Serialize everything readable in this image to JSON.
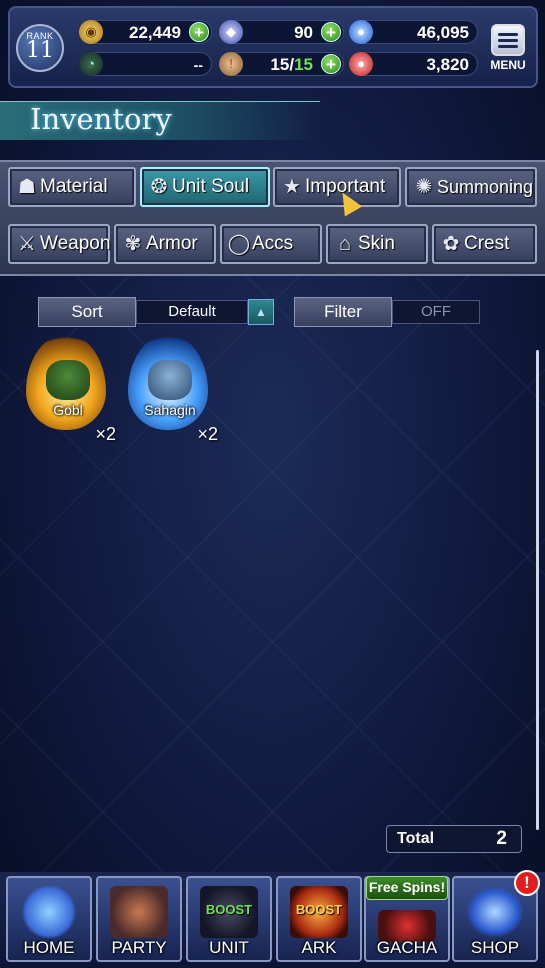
{
  "header": {
    "rank_label": "RANK",
    "rank_value": "11",
    "gil": "22,449",
    "crystals": "90",
    "orbs": "46,095",
    "experience": "--",
    "stamina_current": "15",
    "stamina_sep": "/",
    "stamina_max": "15",
    "red_currency": "3,820",
    "menu_label": "MENU",
    "plus": "+"
  },
  "title": "Inventory",
  "tabs_row1": [
    {
      "label": "Material",
      "icon": "bag-icon"
    },
    {
      "label": "Unit Soul",
      "icon": "soul-icon"
    },
    {
      "label": "Important",
      "icon": "star-icon"
    },
    {
      "label": "Summoning",
      "icon": "summon-icon"
    }
  ],
  "tabs_row2": [
    {
      "label": "Weapon",
      "icon": "sword-icon"
    },
    {
      "label": "Armor",
      "icon": "armor-icon"
    },
    {
      "label": "Accs",
      "icon": "ring-icon"
    },
    {
      "label": "Skin",
      "icon": "hanger-icon"
    },
    {
      "label": "Crest",
      "icon": "crest-icon"
    }
  ],
  "active_tab": "Unit Soul",
  "sort": {
    "label": "Sort",
    "value": "Default",
    "arrow": "▲"
  },
  "filter": {
    "label": "Filter",
    "value": "OFF"
  },
  "items": [
    {
      "name": "Gobl",
      "qty": "×2"
    },
    {
      "name": "Sahagin",
      "qty": "×2"
    }
  ],
  "total": {
    "label": "Total",
    "value": "2"
  },
  "nav": {
    "home": "HOME",
    "party": "PARTY",
    "unit": "UNIT",
    "unit_boost": "BOOST",
    "ark": "ARK",
    "ark_boost": "BOOST",
    "gacha": "GACHA",
    "gacha_banner": "Free Spins!",
    "shop": "SHOP",
    "shop_alert": "!"
  }
}
